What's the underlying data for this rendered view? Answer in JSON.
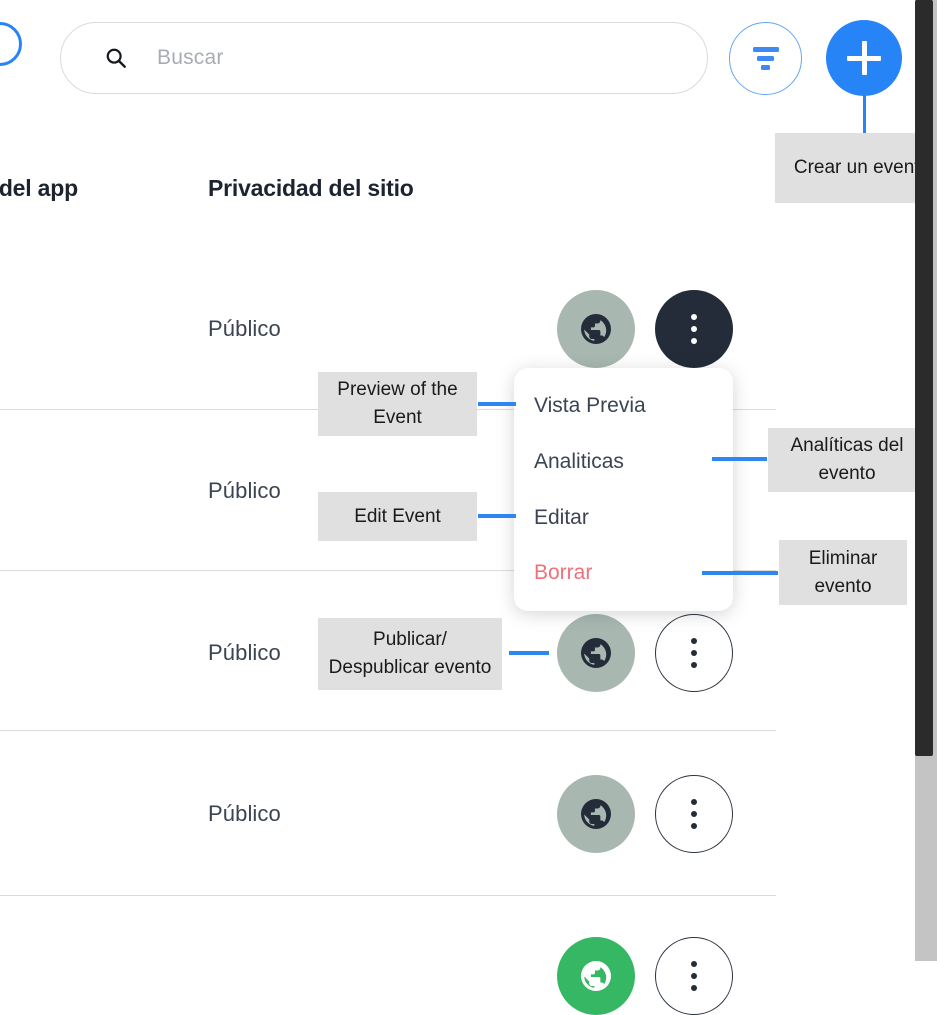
{
  "colors": {
    "accent_blue": "#2684f7",
    "leader_blue": "#2e86f0",
    "globe_gray": "#a8b8b1",
    "globe_green": "#36b764",
    "dots_dark": "#232c38",
    "danger_red": "#f0707a",
    "callout_bg": "#e0e0e0",
    "divider": "#dcdcdc",
    "scrollbar_thumb": "#2b2b2b",
    "scrollbar_track": "#c4c4c4"
  },
  "toolbar": {
    "search": {
      "icon": "search-icon",
      "placeholder": "Buscar",
      "value": ""
    },
    "filter_button": {
      "icon": "filter-icon",
      "label": ""
    },
    "add_button": {
      "icon": "plus-icon",
      "label": ""
    }
  },
  "table": {
    "headers": [
      {
        "label": "lad del app"
      },
      {
        "label": "Privacidad del sitio"
      }
    ],
    "rows": [
      {
        "site_privacy": "Público",
        "globe_state": "gray",
        "menu_state": "open"
      },
      {
        "site_privacy": "Público",
        "globe_state": "gray",
        "menu_state": "closed"
      },
      {
        "site_privacy": "Público",
        "globe_state": "gray",
        "menu_state": "closed"
      },
      {
        "site_privacy": "Público",
        "globe_state": "gray",
        "menu_state": "closed"
      },
      {
        "site_privacy": "",
        "globe_state": "green",
        "menu_state": "closed"
      }
    ]
  },
  "context_menu": {
    "items": [
      {
        "label": "Vista Previa",
        "variant": "normal"
      },
      {
        "label": "Analiticas",
        "variant": "normal"
      },
      {
        "label": "Editar",
        "variant": "normal"
      },
      {
        "label": "Borrar",
        "variant": "danger"
      }
    ]
  },
  "annotations": {
    "create": "Crear un evento",
    "preview": "Preview of the Event",
    "analytics": "Analíticas del evento",
    "edit": "Edit Event",
    "delete": "Eliminar evento",
    "publish": "Publicar/ Despublicar evento"
  }
}
